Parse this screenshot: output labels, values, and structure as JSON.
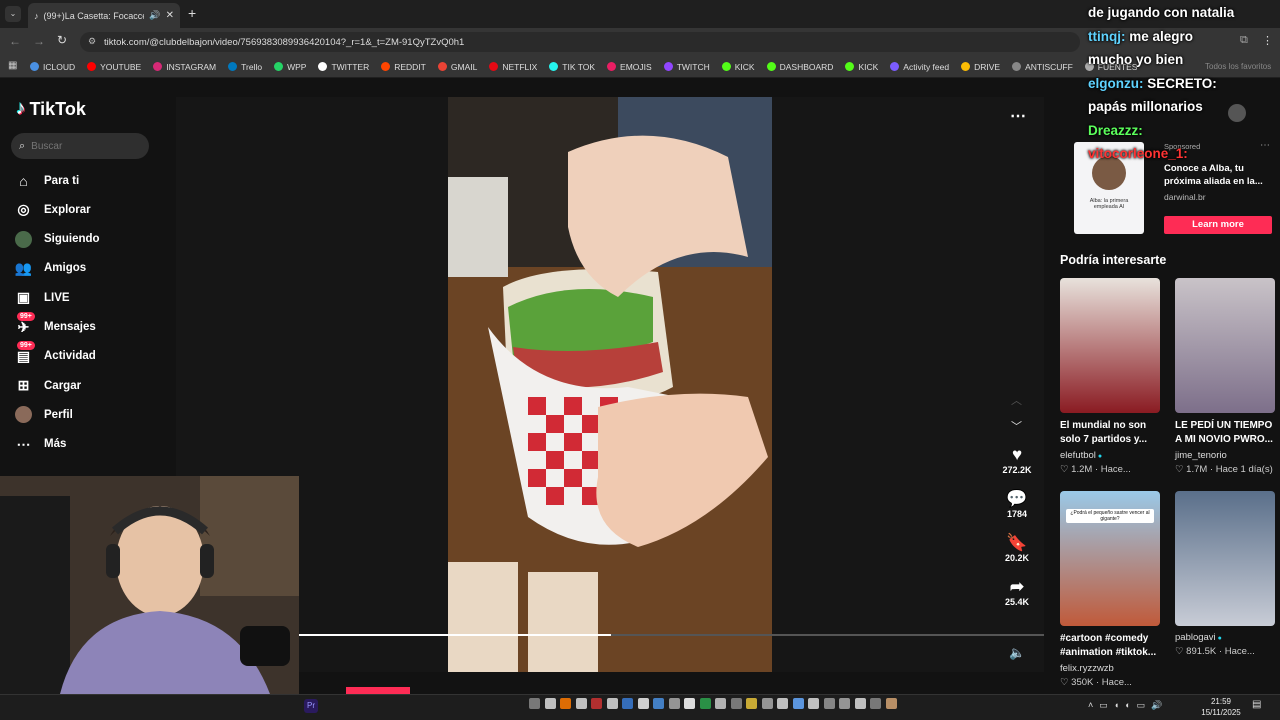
{
  "browser": {
    "tab_title": "(99+)La Casetta: Focacceria",
    "url": "tiktok.com/@clubdelbajon/video/7569383089936420104?_r=1&_t=ZM-91QyTZvQ0h1",
    "all_favorites": "Todos los favoritos",
    "bookmarks": [
      {
        "label": "ICLOUD",
        "color": "#4a90e2"
      },
      {
        "label": "YOUTUBE",
        "color": "#ff0000"
      },
      {
        "label": "INSTAGRAM",
        "color": "#d62976"
      },
      {
        "label": "Trello",
        "color": "#0079bf"
      },
      {
        "label": "WPP",
        "color": "#25d366"
      },
      {
        "label": "TWITTER",
        "color": "#ffffff"
      },
      {
        "label": "REDDIT",
        "color": "#ff4500"
      },
      {
        "label": "GMAIL",
        "color": "#ea4335"
      },
      {
        "label": "NETFLIX",
        "color": "#e50914"
      },
      {
        "label": "TIK TOK",
        "color": "#25f4ee"
      },
      {
        "label": "EMOJIS",
        "color": "#e91e63"
      },
      {
        "label": "TWITCH",
        "color": "#9146ff"
      },
      {
        "label": "KICK",
        "color": "#53fc18"
      },
      {
        "label": "DASHBOARD",
        "color": "#53fc18"
      },
      {
        "label": "KICK",
        "color": "#53fc18"
      },
      {
        "label": "Activity feed",
        "color": "#7b5cff"
      },
      {
        "label": "DRIVE",
        "color": "#fbbc04"
      },
      {
        "label": "ANTISCUFF",
        "color": "#888888"
      },
      {
        "label": "FUENTES",
        "color": "#aaaaaa"
      }
    ]
  },
  "sidebar": {
    "logo": "TikTok",
    "search_placeholder": "Buscar",
    "items": [
      {
        "label": "Para ti",
        "icon": "home-icon"
      },
      {
        "label": "Explorar",
        "icon": "compass-icon"
      },
      {
        "label": "Siguiendo",
        "icon": "following-avatar"
      },
      {
        "label": "Amigos",
        "icon": "friends-icon"
      },
      {
        "label": "LIVE",
        "icon": "live-icon"
      },
      {
        "label": "Mensajes",
        "icon": "messages-icon",
        "badge": "99+"
      },
      {
        "label": "Actividad",
        "icon": "activity-icon",
        "badge": "99+"
      },
      {
        "label": "Cargar",
        "icon": "upload-icon"
      },
      {
        "label": "Perfil",
        "icon": "profile-avatar"
      },
      {
        "label": "Más",
        "icon": "more-icon"
      }
    ]
  },
  "actions": {
    "likes": "272.2K",
    "comments": "1784",
    "saves": "20.2K",
    "shares": "25.4K"
  },
  "ad": {
    "sponsored": "Sponsored",
    "text": "Conoce a Alba, tu próxima aliada en la...",
    "domain": "darwinal.br",
    "cta": "Learn more",
    "thumb_text": "Alba: la primera empleada AI"
  },
  "recommendations": {
    "heading": "Podría interesarte",
    "items": [
      {
        "title": "El mundial no son solo 7 partidos y...",
        "author": "elefutbol",
        "verified": true,
        "likes": "1.2M",
        "time": "Hace...",
        "colors": [
          "#e8e2dc",
          "#8a1b22"
        ]
      },
      {
        "title": "LE PEDÍ UN TIEMPO A MI NOVIO PWRO...",
        "author": "jime_tenorio",
        "verified": false,
        "likes": "1.7M",
        "time": "Hace 1 día(s)",
        "colors": [
          "#c9c3c8",
          "#7d6f8a"
        ]
      },
      {
        "title": "#cartoon #comedy #animation #tiktok...",
        "author": "felix.ryzzwzb",
        "verified": false,
        "likes": "350K",
        "time": "Hace...",
        "colors": [
          "#9ac9e8",
          "#c05a3a"
        ],
        "thumb_caption": "¿Podrá el pequeño sastre vencer al gigante?"
      },
      {
        "title": "",
        "author": "pablogavi",
        "verified": true,
        "likes": "891.5K",
        "time": "Hace...",
        "colors": [
          "#5a6f8a",
          "#c8ccd6"
        ]
      }
    ]
  },
  "chat": [
    {
      "user": "",
      "text": "de jugando con natalia",
      "user_color": "#ffffff"
    },
    {
      "user": "ttinqj:",
      "text": "me alegro",
      "user_color": "#5fd3ff"
    },
    {
      "user": "",
      "text": "mucho yo bien",
      "user_color": "#ffffff"
    },
    {
      "user": "elgonzu:",
      "text": "SECRETO:",
      "user_color": "#5fd3ff"
    },
    {
      "user": "",
      "text": "papás millonarios",
      "user_color": "#ffffff"
    },
    {
      "user": "Dreazzz:",
      "text": "",
      "user_color": "#5cff5c"
    },
    {
      "user": "vitocorleone_1:",
      "text": "",
      "user_color": "#ff3333"
    }
  ],
  "taskbar": {
    "time": "21:59",
    "date": "15/11/2025"
  },
  "progress": 0.42
}
